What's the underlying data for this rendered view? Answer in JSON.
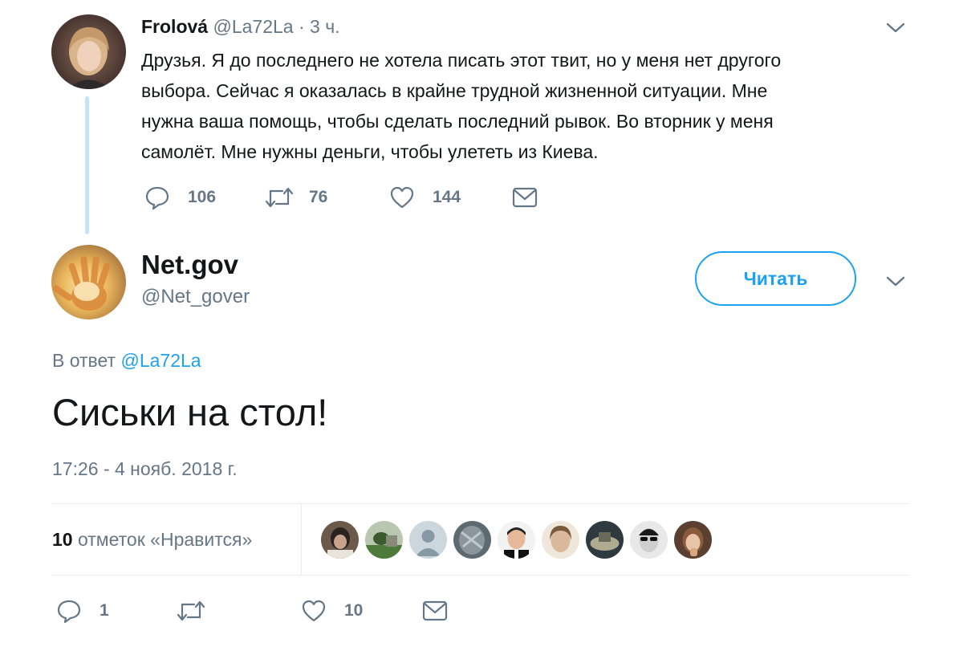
{
  "reply_parent": {
    "display_name": "Frolová",
    "handle": "@La72La",
    "separator": "·",
    "time": "3 ч.",
    "text_lines": [
      "Друзья. Я до последнего не хотела писать этот твит, но у меня нет другого",
      "выбора. Сейчас я оказалась в крайне трудной жизненной ситуации. Мне",
      "нужна ваша помощь, чтобы сделать последний рывок. Во вторник у меня",
      "самолёт. Мне нужны деньги, чтобы улететь из Киева."
    ],
    "replies": "106",
    "retweets": "76",
    "likes": "144"
  },
  "main_tweet": {
    "display_name": "Net.gov",
    "handle": "@Net_gover",
    "follow_label": "Читать",
    "reply_to_prefix": "В ответ",
    "reply_to_handle": "@La72La",
    "text": "Сиськи на стол!",
    "timestamp": "17:26 - 4 нояб. 2018 г.",
    "likes_count": "10",
    "likes_label": "отметок «Нравится»",
    "replies": "1",
    "retweets": "",
    "likes": "10"
  },
  "icons": {
    "reply": "reply-icon",
    "retweet": "retweet-icon",
    "like": "heart-icon",
    "dm": "envelope-icon",
    "caret": "chevron-down-icon"
  },
  "colors": {
    "accent": "#1da1f2",
    "muted": "#657786",
    "thread_line": "#c4e4f7",
    "divider": "#e6ecf0"
  }
}
